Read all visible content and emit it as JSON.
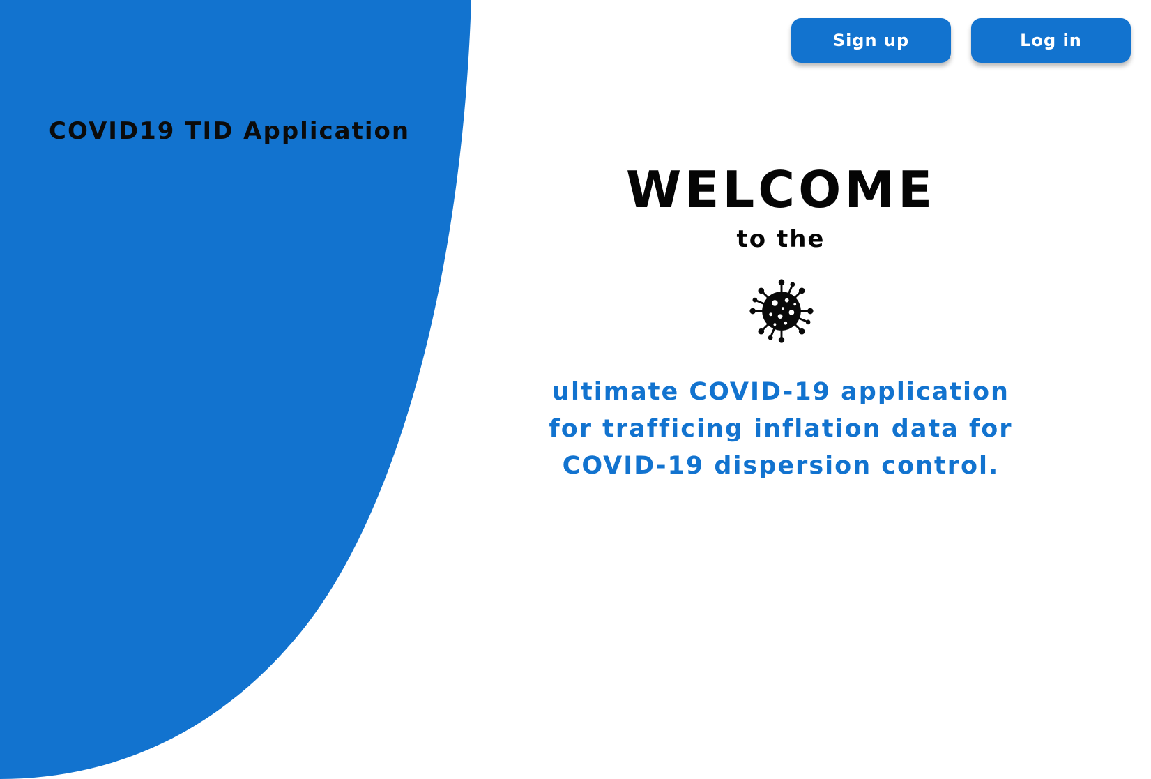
{
  "app": {
    "title": "COVID19 TID Application"
  },
  "nav": {
    "signup_label": "Sign up",
    "login_label": "Log in"
  },
  "hero": {
    "heading": "WELCOME",
    "subheading": "to the",
    "icon": "virus-icon",
    "tagline_lines": [
      "ultimate COVID-19 application",
      "for trafficing inflation data for",
      "COVID-19 dispersion control."
    ]
  },
  "colors": {
    "accent": "#1273cf",
    "background": "#ffffff",
    "text": "#050505"
  }
}
